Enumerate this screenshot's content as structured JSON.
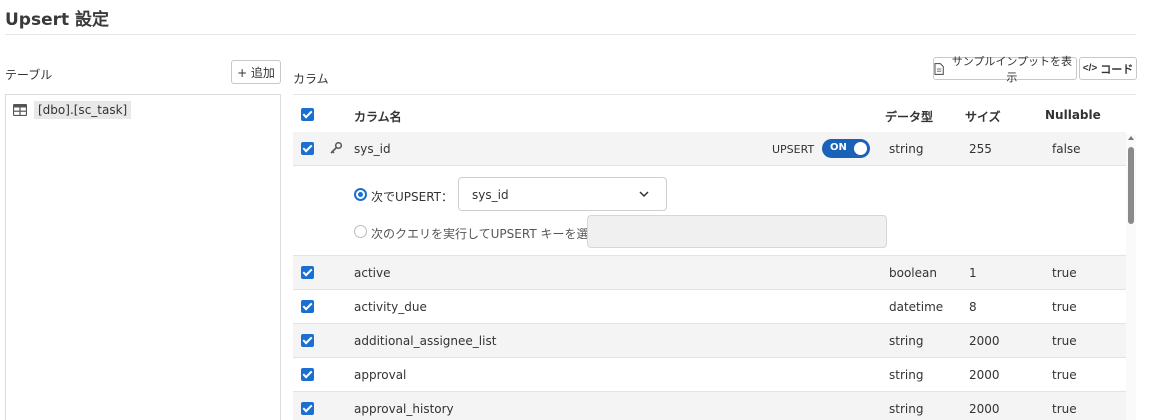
{
  "page": {
    "title": "Upsert 設定"
  },
  "tables": {
    "label": "テーブル",
    "add_label": "+ 追加",
    "items": [
      {
        "name": "[dbo].[sc_task]",
        "icon": "table-icon"
      }
    ]
  },
  "columns": {
    "label": "カラム",
    "sample_input_label": "サンプルインプットを表示",
    "code_label": "コード",
    "headers": {
      "name": "カラム名",
      "type": "データ型",
      "size": "サイズ",
      "nullable": "Nullable"
    },
    "rows": [
      {
        "name": "sys_id",
        "type": "string",
        "size": "255",
        "nullable": "false",
        "checked": true,
        "key": true,
        "upsert": true
      },
      {
        "name": "active",
        "type": "boolean",
        "size": "1",
        "nullable": "true",
        "checked": true
      },
      {
        "name": "activity_due",
        "type": "datetime",
        "size": "8",
        "nullable": "true",
        "checked": true
      },
      {
        "name": "additional_assignee_list",
        "type": "string",
        "size": "2000",
        "nullable": "true",
        "checked": true
      },
      {
        "name": "approval",
        "type": "string",
        "size": "2000",
        "nullable": "true",
        "checked": true
      },
      {
        "name": "approval_history",
        "type": "string",
        "size": "2000",
        "nullable": "true",
        "checked": true
      }
    ]
  },
  "upsert": {
    "row_label": "UPSERT",
    "toggle_label": "ON",
    "option_next_label": "次でUPSERT：",
    "selected_key": "sys_id",
    "option_query_label": "次のクエリを実行してUPSERT キーを選択",
    "query_value": ""
  },
  "colors": {
    "accent": "#1c6fd1",
    "toggle": "#1a61b8"
  }
}
